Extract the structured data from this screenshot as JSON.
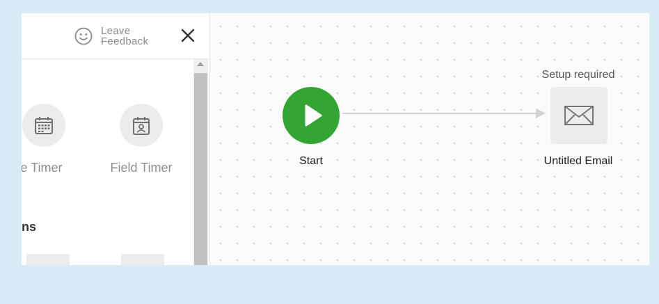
{
  "panel": {
    "feedback": {
      "label": "Leave\nFeedback",
      "icon": "smiley-icon"
    },
    "close_icon": "close-icon",
    "tools": [
      {
        "label": "ate Timer",
        "icon": "calendar-icon"
      },
      {
        "label": "Field Timer",
        "icon": "contact-calendar-icon"
      }
    ],
    "section_title": "ns"
  },
  "canvas": {
    "start_node": {
      "label": "Start",
      "color": "#33a532",
      "icon": "play-icon"
    },
    "email_node": {
      "label": "Untitled Email",
      "status": "Setup required",
      "icon": "envelope-icon"
    }
  },
  "colors": {
    "background": "#d9ebf6",
    "start_green": "#33a532",
    "node_gray": "#ececec"
  }
}
